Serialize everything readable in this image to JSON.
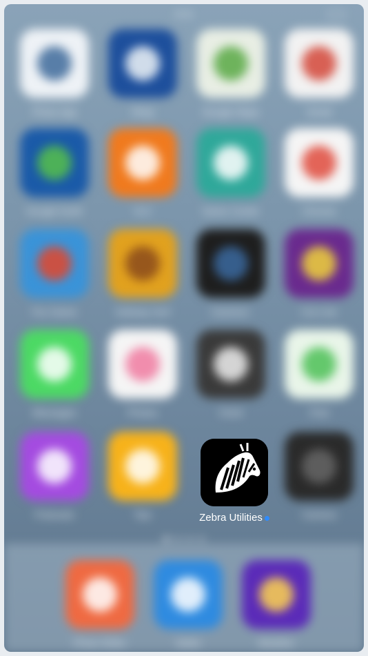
{
  "status_bar": {
    "time": "9:41"
  },
  "apps": [
    {
      "row": 0,
      "col": 0,
      "label": "Photo App",
      "color": "#eef2f6",
      "accent": "#3d6a9a"
    },
    {
      "row": 0,
      "col": 1,
      "label": "Shop",
      "color": "#1d4f9c",
      "accent": "#f0f4f8"
    },
    {
      "row": 0,
      "col": 2,
      "label": "Google Maps",
      "color": "#e8eee4",
      "accent": "#58a844"
    },
    {
      "row": 0,
      "col": 3,
      "label": "Gmail",
      "color": "#f2f2f2",
      "accent": "#d44638"
    },
    {
      "row": 1,
      "col": 0,
      "label": "Google Earth",
      "color": "#1a5aa8",
      "accent": "#57c14a"
    },
    {
      "row": 1,
      "col": 1,
      "label": "VLC",
      "color": "#f07a1e",
      "accent": "#ffffff"
    },
    {
      "row": 1,
      "col": 2,
      "label": "Game Center",
      "color": "#2fa89a",
      "accent": "#ffffff"
    },
    {
      "row": 1,
      "col": 3,
      "label": "Chrome",
      "color": "#f5f5f5",
      "accent": "#df4a3c"
    },
    {
      "row": 2,
      "col": 0,
      "label": "Fox Game",
      "color": "#3a93d8",
      "accent": "#e4452a"
    },
    {
      "row": 2,
      "col": 1,
      "label": "Subway Surf",
      "color": "#e1a11e",
      "accent": "#8a4a1c"
    },
    {
      "row": 2,
      "col": 2,
      "label": "Camera+",
      "color": "#1e1e1e",
      "accent": "#3b6aa0"
    },
    {
      "row": 2,
      "col": 3,
      "label": "Cut Line",
      "color": "#6a2a8e",
      "accent": "#f0d23a"
    },
    {
      "row": 3,
      "col": 0,
      "label": "Messages",
      "color": "#4cd964",
      "accent": "#ffffff"
    },
    {
      "row": 3,
      "col": 1,
      "label": "Photos",
      "color": "#f5f5f5",
      "accent": "#f07aa0"
    },
    {
      "row": 3,
      "col": 2,
      "label": "Clock",
      "color": "#3a3a3a",
      "accent": "#f0f0f0"
    },
    {
      "row": 3,
      "col": 3,
      "label": "Find",
      "color": "#e9f5e9",
      "accent": "#4cbf56"
    },
    {
      "row": 4,
      "col": 0,
      "label": "Podcasts",
      "color": "#a44be0",
      "accent": "#ffffff"
    },
    {
      "row": 4,
      "col": 1,
      "label": "Tips",
      "color": "#f7b21a",
      "accent": "#ffffff"
    },
    {
      "row": 4,
      "col": 3,
      "label": "Camera",
      "color": "#2a2a2a",
      "accent": "#666666"
    }
  ],
  "focused_app": {
    "label": "Zebra Utilities"
  },
  "page_indicator": {
    "pages": 4,
    "current": 1
  },
  "dock": [
    {
      "label": "Photo Editor",
      "color": "#ef6a42",
      "accent": "#ffffff"
    },
    {
      "label": "Safari",
      "color": "#2f8be0",
      "accent": "#ffffff"
    },
    {
      "label": "Weather",
      "color": "#5b2bb8",
      "accent": "#ffd34d"
    }
  ]
}
